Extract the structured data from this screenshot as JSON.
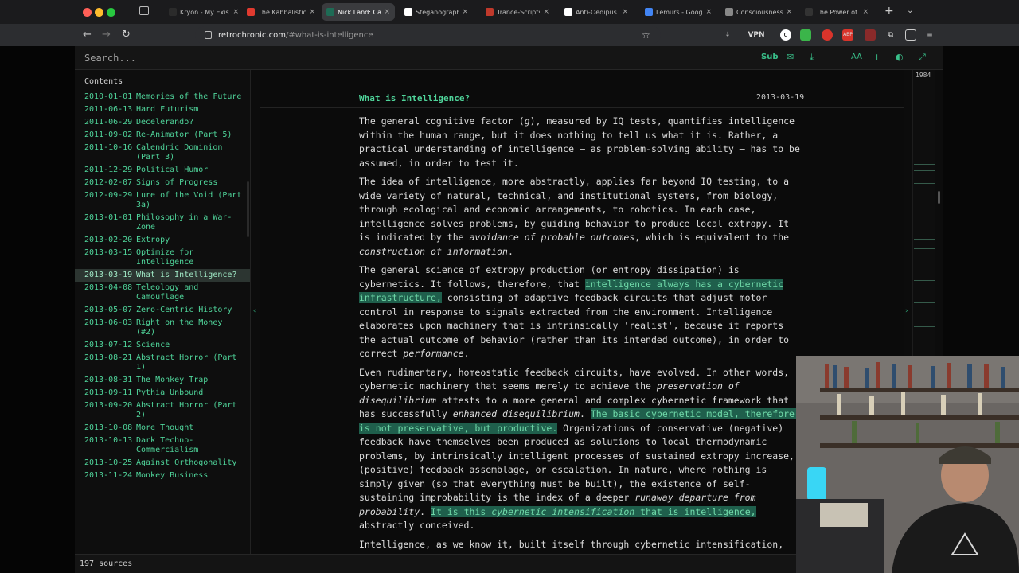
{
  "browser": {
    "tabs": [
      {
        "title": "Kryon - My Exist",
        "icon": "tab-favicon-icon",
        "color": "#2b2b2b"
      },
      {
        "title": "The Kabbalistic V",
        "icon": "youtube-icon",
        "color": "#e03a2f"
      },
      {
        "title": "Nick Land: Capit",
        "icon": "retrochronic-icon",
        "color": "#1e6b55"
      },
      {
        "title": "Steganography",
        "icon": "wikipedia-icon",
        "color": "#ffffff"
      },
      {
        "title": "Trance-Scripts",
        "icon": "tab-favicon-icon",
        "color": "#c0392b"
      },
      {
        "title": "Anti-Oedipus",
        "icon": "wikipedia-icon",
        "color": "#ffffff"
      },
      {
        "title": "Lemurs - Google",
        "icon": "google-icon",
        "color": "#4285f4"
      },
      {
        "title": "Consciousness i",
        "icon": "tab-favicon-icon",
        "color": "#888888"
      },
      {
        "title": "The Power of Zero -",
        "icon": "tab-favicon-icon",
        "color": "#333333"
      }
    ],
    "url": {
      "host": "retrochronic.com",
      "path": "/#what-is-intelligence"
    },
    "vpn_label": "VPN"
  },
  "page": {
    "search_placeholder": "Search...",
    "toolbar": {
      "sub_label": "Sub",
      "font_label": "AA"
    },
    "contents_label": "Contents",
    "toc": [
      {
        "date": "2010-01-01",
        "title": "Memories of the Future"
      },
      {
        "date": "2011-06-13",
        "title": "Hard Futurism"
      },
      {
        "date": "2011-06-29",
        "title": "Decelerando?"
      },
      {
        "date": "2011-09-02",
        "title": "Re-Animator (Part 5)"
      },
      {
        "date": "2011-10-16",
        "title": "Calendric Dominion (Part 3)"
      },
      {
        "date": "2011-12-29",
        "title": "Political Humor"
      },
      {
        "date": "2012-02-07",
        "title": "Signs of Progress"
      },
      {
        "date": "2012-09-29",
        "title": "Lure of the Void (Part 3a)"
      },
      {
        "date": "2013-01-01",
        "title": "Philosophy in a War-Zone"
      },
      {
        "date": "2013-02-20",
        "title": "Extropy"
      },
      {
        "date": "2013-03-15",
        "title": "Optimize for Intelligence"
      },
      {
        "date": "2013-03-19",
        "title": "What is Intelligence?",
        "selected": true
      },
      {
        "date": "2013-04-08",
        "title": "Teleology and Camouflage"
      },
      {
        "date": "2013-05-07",
        "title": "Zero-Centric History"
      },
      {
        "date": "2013-06-03",
        "title": "Right on the Money (#2)"
      },
      {
        "date": "2013-07-12",
        "title": "Science"
      },
      {
        "date": "2013-08-21",
        "title": "Abstract Horror (Part 1)"
      },
      {
        "date": "2013-08-31",
        "title": "The Monkey Trap"
      },
      {
        "date": "2013-09-11",
        "title": "Pythia Unbound"
      },
      {
        "date": "2013-09-20",
        "title": "Abstract Horror (Part 2)"
      },
      {
        "date": "2013-10-08",
        "title": "More Thought"
      },
      {
        "date": "2013-10-13",
        "title": "Dark Techno-Commercialism"
      },
      {
        "date": "2013-10-25",
        "title": "Against Orthogonality"
      },
      {
        "date": "2013-11-24",
        "title": "Monkey Business"
      }
    ],
    "article": {
      "title": "What is Intelligence?",
      "date": "2013-03-19",
      "paragraphs": [
        [
          {
            "t": "The general cognitive factor ("
          },
          {
            "t": "g",
            "em": true
          },
          {
            "t": "), measured by IQ tests, quantifies intelligence within the human range, but it does nothing to tell us what it is. Rather, a practical understanding of intelligence — as problem-solving ability — has to be assumed, in order to test it."
          }
        ],
        [
          {
            "t": "The idea of intelligence, more abstractly, applies far beyond IQ testing, to a wide variety of natural, technical, and institutional systems, from biology, through ecological and economic arrangements, to robotics. In each case, intelligence solves problems, by guiding behavior to produce local extropy. It is indicated by the "
          },
          {
            "t": "avoidance of probable outcomes",
            "em": true
          },
          {
            "t": ", which is equivalent to the "
          },
          {
            "t": "construction of information",
            "em": true
          },
          {
            "t": "."
          }
        ],
        [
          {
            "t": "The general science of extropy production (or entropy dissipation) is cybernetics. It follows, therefore, that "
          },
          {
            "t": "intelligence always has a cybernetic infrastructure,",
            "hl": true
          },
          {
            "t": " consisting of adaptive feedback circuits that adjust motor control in response to signals extracted from the environment. Intelligence elaborates upon machinery that is intrinsically 'realist', because it reports the actual outcome of behavior (rather than its intended outcome), in order to correct "
          },
          {
            "t": "performance",
            "em": true
          },
          {
            "t": "."
          }
        ],
        [
          {
            "t": "Even rudimentary, homeostatic feedback circuits, have evolved. In other words, cybernetic machinery that seems merely to achieve the "
          },
          {
            "t": "preservation of disequilibrium",
            "em": true
          },
          {
            "t": " attests to a more general and complex cybernetic framework that has successfully "
          },
          {
            "t": "enhanced disequilibrium",
            "em": true
          },
          {
            "t": ". "
          },
          {
            "t": "The basic cybernetic model, therefore, is not preservative, but productive.",
            "hl": true
          },
          {
            "t": " Organizations of conservative (negative) feedback have themselves been produced as solutions to local thermodynamic problems, by intrinsically intelligent processes of sustained extropy increase, (positive) feedback assemblage, or escalation. In nature, where nothing is simply given (so that everything must be built), the existence of self-sustaining improbability is the index of a deeper "
          },
          {
            "t": "runaway departure from probability",
            "em": true
          },
          {
            "t": ". "
          },
          {
            "t": "It is this ",
            "hl": true
          },
          {
            "t": "cybernetic intensification",
            "hl": true,
            "em": true
          },
          {
            "t": " that is intelligence,",
            "hl": true
          },
          {
            "t": " abstractly conceived."
          }
        ],
        [
          {
            "t": "Intelligence, as we know it, built itself through cybernetic intensification,"
          }
        ]
      ]
    },
    "minimap_year": "1984",
    "sources_count": "197 sources"
  },
  "colors": {
    "accent": "#4fd49a",
    "highlight_bg": "#1f5f4c",
    "background": "#0b0b0b"
  }
}
